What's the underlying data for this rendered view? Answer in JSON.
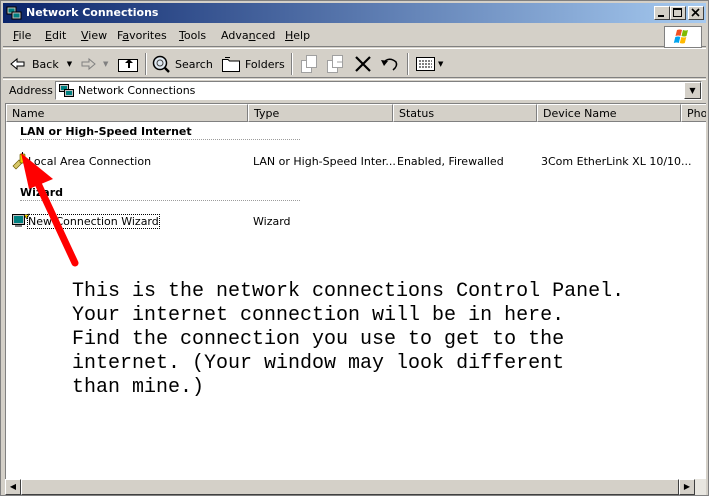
{
  "window": {
    "title": "Network Connections"
  },
  "menu": {
    "items": [
      {
        "label": "File",
        "u": "F",
        "rest": "ile"
      },
      {
        "label": "Edit",
        "u": "E",
        "rest": "dit"
      },
      {
        "label": "View",
        "u": "V",
        "rest": "iew"
      },
      {
        "label": "Favorites",
        "u": "",
        "pre": "F",
        "u2": "a",
        "rest": "vorites"
      },
      {
        "label": "Tools",
        "u": "T",
        "rest": "ools"
      },
      {
        "label": "Advanced",
        "u": "",
        "pre": "Adva",
        "u2": "n",
        "rest": "ced"
      },
      {
        "label": "Help",
        "u": "H",
        "rest": "elp"
      }
    ]
  },
  "toolbar": {
    "back_label": "Back",
    "search_label": "Search",
    "folders_label": "Folders"
  },
  "address": {
    "label": "Address",
    "value": "Network Connections"
  },
  "columns": [
    "Name",
    "Type",
    "Status",
    "Device Name",
    "Pho"
  ],
  "groups": [
    {
      "title": "LAN or High-Speed Internet",
      "rows": [
        {
          "name": "Local Area Connection",
          "type": "LAN or High-Speed Inter...",
          "status": "Enabled, Firewalled",
          "device": "3Com EtherLink XL 10/10..."
        }
      ]
    },
    {
      "title": "Wizard",
      "rows": [
        {
          "name": "New Connection Wizard",
          "type": "Wizard",
          "status": "",
          "device": ""
        }
      ]
    }
  ],
  "annotation": "This is the network connections Control Panel.\nYour internet connection will be in here.\nFind the connection you use to get to the\ninternet. (Your window may look different\nthan mine.)",
  "colors": {
    "titlebar_start": "#0a246a",
    "titlebar_end": "#a6caf0",
    "arrow": "#ff0000",
    "face": "#d4d0c8"
  },
  "icons": [
    "network-connections-icon",
    "minimize-icon",
    "maximize-icon",
    "close-icon",
    "windows-logo-icon",
    "back-arrow-icon",
    "forward-arrow-icon",
    "up-folder-icon",
    "search-icon",
    "folders-icon",
    "move-to-icon",
    "copy-to-icon",
    "delete-icon",
    "undo-icon",
    "views-icon",
    "lan-connection-icon",
    "wizard-icon"
  ]
}
